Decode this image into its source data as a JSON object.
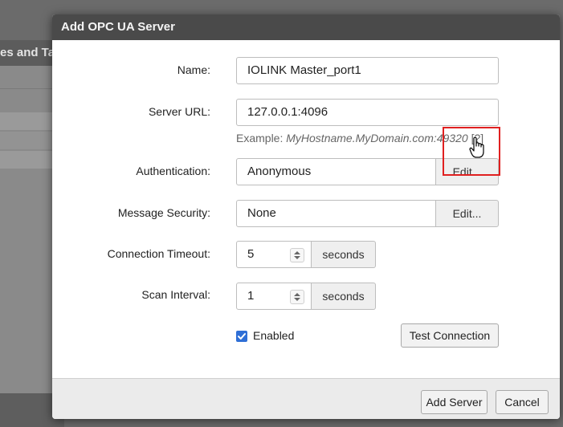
{
  "background": {
    "panel_header": "es and Ta"
  },
  "dialog": {
    "title": "Add OPC UA Server",
    "fields": {
      "name": {
        "label": "Name:",
        "value": "IOLINK Master_port1"
      },
      "server_url": {
        "label": "Server URL:",
        "value": "127.0.0.1:4096",
        "example_prefix": "Example: ",
        "example_value": "MyHostname.MyDomain.com:49320",
        "help_link": "[?]"
      },
      "authentication": {
        "label": "Authentication:",
        "value": "Anonymous",
        "edit_label": "Edit..."
      },
      "message_security": {
        "label": "Message Security:",
        "value": "None",
        "edit_label": "Edit..."
      },
      "connection_timeout": {
        "label": "Connection Timeout:",
        "value": "5",
        "unit": "seconds"
      },
      "scan_interval": {
        "label": "Scan Interval:",
        "value": "1",
        "unit": "seconds"
      }
    },
    "enabled": {
      "label": "Enabled",
      "checked": true
    },
    "test_connection_label": "Test Connection",
    "footer": {
      "add_server_label": "Add Server",
      "cancel_label": "Cancel"
    }
  },
  "colors": {
    "title_bar": "#4a4a4a",
    "checkbox_accent": "#2f6fd6",
    "highlight_box": "#e02020"
  }
}
